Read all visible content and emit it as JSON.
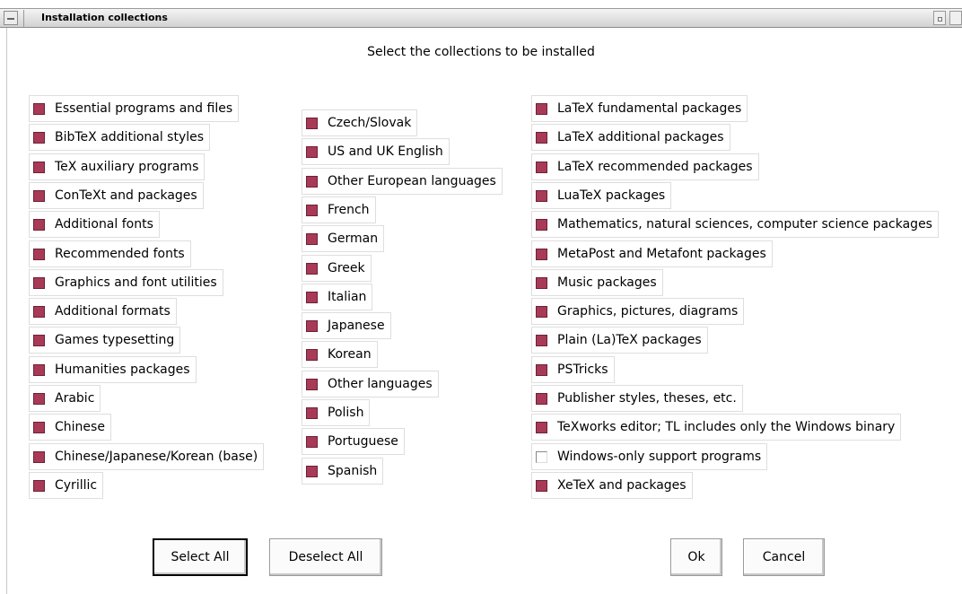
{
  "window": {
    "title": "Installation collections"
  },
  "heading": "Select the collections to be installed",
  "columns": [
    {
      "items": [
        {
          "label": "Essential programs and files",
          "checked": true
        },
        {
          "label": "BibTeX additional styles",
          "checked": true
        },
        {
          "label": "TeX auxiliary programs",
          "checked": true
        },
        {
          "label": "ConTeXt and packages",
          "checked": true
        },
        {
          "label": "Additional fonts",
          "checked": true
        },
        {
          "label": "Recommended fonts",
          "checked": true
        },
        {
          "label": "Graphics and font utilities",
          "checked": true
        },
        {
          "label": "Additional formats",
          "checked": true
        },
        {
          "label": "Games typesetting",
          "checked": true
        },
        {
          "label": "Humanities packages",
          "checked": true
        },
        {
          "label": "Arabic",
          "checked": true
        },
        {
          "label": "Chinese",
          "checked": true
        },
        {
          "label": "Chinese/Japanese/Korean (base)",
          "checked": true
        },
        {
          "label": "Cyrillic",
          "checked": true
        }
      ]
    },
    {
      "items": [
        {
          "label": "Czech/Slovak",
          "checked": true
        },
        {
          "label": "US and UK English",
          "checked": true
        },
        {
          "label": "Other European languages",
          "checked": true
        },
        {
          "label": "French",
          "checked": true
        },
        {
          "label": "German",
          "checked": true
        },
        {
          "label": "Greek",
          "checked": true
        },
        {
          "label": "Italian",
          "checked": true
        },
        {
          "label": "Japanese",
          "checked": true
        },
        {
          "label": "Korean",
          "checked": true
        },
        {
          "label": "Other languages",
          "checked": true
        },
        {
          "label": "Polish",
          "checked": true
        },
        {
          "label": "Portuguese",
          "checked": true
        },
        {
          "label": "Spanish",
          "checked": true
        }
      ]
    },
    {
      "items": [
        {
          "label": "LaTeX fundamental packages",
          "checked": true
        },
        {
          "label": "LaTeX additional packages",
          "checked": true
        },
        {
          "label": "LaTeX recommended packages",
          "checked": true
        },
        {
          "label": "LuaTeX packages",
          "checked": true
        },
        {
          "label": "Mathematics, natural sciences, computer science packages",
          "checked": true
        },
        {
          "label": "MetaPost and Metafont packages",
          "checked": true
        },
        {
          "label": "Music packages",
          "checked": true
        },
        {
          "label": "Graphics, pictures, diagrams",
          "checked": true
        },
        {
          "label": "Plain (La)TeX packages",
          "checked": true
        },
        {
          "label": "PSTricks",
          "checked": true
        },
        {
          "label": "Publisher styles, theses, etc.",
          "checked": true
        },
        {
          "label": "TeXworks editor; TL includes only the Windows binary",
          "checked": true
        },
        {
          "label": "Windows-only support programs",
          "checked": false
        },
        {
          "label": "XeTeX and packages",
          "checked": true
        }
      ]
    }
  ],
  "buttons": {
    "select_all": "Select All",
    "deselect_all": "Deselect All",
    "ok": "Ok",
    "cancel": "Cancel"
  },
  "colors": {
    "checked_fill": "#a83a57"
  }
}
